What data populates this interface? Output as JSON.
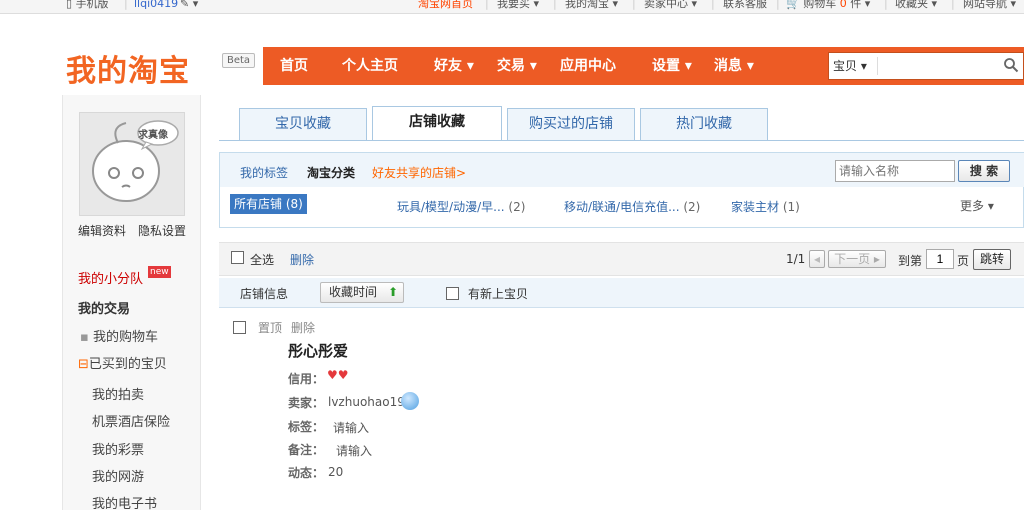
{
  "topbar": {
    "mobile": "手机版",
    "username": "llqi0419",
    "taobao_home": "淘宝网首页",
    "buy": "我要买",
    "my_taobao": "我的淘宝",
    "seller_center": "卖家中心",
    "contact": "联系客服",
    "cart": "购物车",
    "cart_count": "0",
    "cart_unit": "件",
    "favorites": "收藏夹",
    "site_nav": "网站导航"
  },
  "header": {
    "logo": "我的淘宝",
    "beta": "Beta",
    "nav": [
      "首页",
      "个人主页",
      "好友",
      "交易",
      "应用中心",
      "设置",
      "消息"
    ],
    "search_type": "宝贝"
  },
  "sidebar": {
    "avatar_bubble": "求真像",
    "edit_profile": "编辑资料",
    "privacy": "隐私设置",
    "team": "我的小分队",
    "new_badge": "new",
    "my_trade": "我的交易",
    "items": [
      "我的购物车",
      "已买到的宝贝",
      "我的拍卖",
      "机票酒店保险",
      "我的彩票",
      "我的网游",
      "我的电子书"
    ]
  },
  "tabs": [
    "宝贝收藏",
    "店铺收藏",
    "购买过的店铺",
    "热门收藏"
  ],
  "filter": {
    "my_tags": "我的标签",
    "taobao_category": "淘宝分类",
    "friends_shared": "好友共享的店铺>",
    "search_placeholder": "请输入名称",
    "search_button": "搜 索",
    "categories": [
      {
        "label": "所有店铺",
        "count": "(8)"
      },
      {
        "label": "玩具/模型/动漫/早...",
        "count": "(2)"
      },
      {
        "label": "移动/联通/电信充值...",
        "count": "(2)"
      },
      {
        "label": "家装主材",
        "count": "(1)"
      }
    ],
    "more": "更多"
  },
  "toolbar": {
    "select_all": "全选",
    "delete": "删除",
    "page_info": "1/1",
    "next_page": "下一页",
    "goto": "到第",
    "page_value": "1",
    "page_unit": "页",
    "jump": "跳转"
  },
  "sortbar": {
    "shop_info": "店铺信息",
    "collect_time": "收藏时间",
    "has_new": "有新上宝贝"
  },
  "shop": {
    "pin": "置顶",
    "delete": "删除",
    "name": "彤心彤爱",
    "credit_label": "信用：",
    "seller_label": "卖家：",
    "seller": "lvzhuohao19",
    "tag_label": "标签：",
    "tag_value": "请输入",
    "note_label": "备注：",
    "note_value": "请输入",
    "activity_label": "动态：",
    "activity_value": "20"
  },
  "colors": {
    "brand": "#ed5b25",
    "link": "#3368aa",
    "accent_orange": "#f40"
  }
}
